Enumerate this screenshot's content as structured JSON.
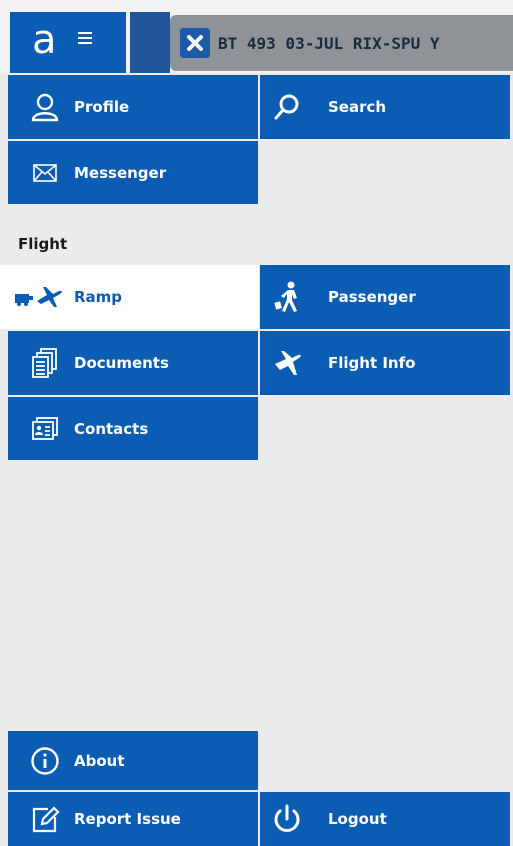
{
  "header": {
    "logo_letter": "a",
    "flight_info": "BT 493  03-JUL  RIX-SPU  Y"
  },
  "menu": {
    "profile": "Profile",
    "search": "Search",
    "messenger": "Messenger",
    "section_flight": "Flight",
    "ramp": "Ramp",
    "passenger": "Passenger",
    "documents": "Documents",
    "flight_info": "Flight Info",
    "contacts": "Contacts",
    "about": "About",
    "report_issue": "Report Issue",
    "logout": "Logout"
  },
  "colors": {
    "tile": "#0b5cb3",
    "background": "#ebebed",
    "active_tile": "#ffffff"
  }
}
